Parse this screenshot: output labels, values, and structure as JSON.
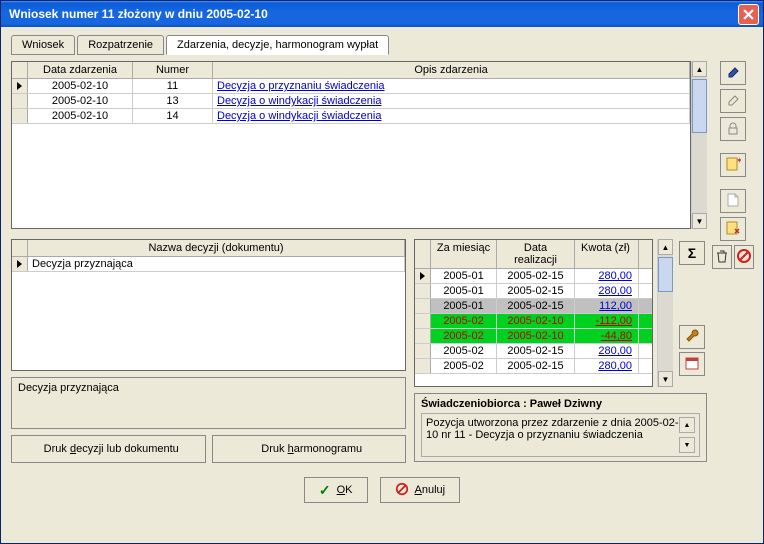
{
  "window_title": "Wniosek numer 11 złożony w dniu 2005-02-10",
  "tabs": [
    "Wniosek",
    "Rozpatrzenie",
    "Zdarzenia, decyzje, harmonogram wypłat"
  ],
  "active_tab": 2,
  "events_grid": {
    "headers": {
      "date": "Data zdarzenia",
      "number": "Numer",
      "desc": "Opis zdarzenia"
    },
    "rows": [
      {
        "date": "2005-02-10",
        "number": "11",
        "desc": "Decyzja o przyznaniu świadczenia"
      },
      {
        "date": "2005-02-10",
        "number": "13",
        "desc": "Decyzja o windykacji świadczenia"
      },
      {
        "date": "2005-02-10",
        "number": "14",
        "desc": "Decyzja o windykacji świadczenia"
      }
    ],
    "selected_row": 0
  },
  "decisions_grid": {
    "header": "Nazwa decyzji (dokumentu)",
    "rows": [
      {
        "name": "Decyzja przyznająca"
      }
    ],
    "selected_row": 0
  },
  "decision_description": "Decyzja przyznająca",
  "schedule_grid": {
    "headers": {
      "month": "Za miesiąc",
      "date": "Data realizacji",
      "amount": "Kwota (zł)"
    },
    "rows": [
      {
        "month": "2005-01",
        "date": "2005-02-15",
        "amount": "280,00",
        "style": "blue",
        "selected": true
      },
      {
        "month": "2005-01",
        "date": "2005-02-15",
        "amount": "280,00",
        "style": "blue"
      },
      {
        "month": "2005-01",
        "date": "2005-02-15",
        "amount": "112,00",
        "style": "gray-blue"
      },
      {
        "month": "2005-02",
        "date": "2005-02-10",
        "amount": "-112,00",
        "style": "green-red"
      },
      {
        "month": "2005-02",
        "date": "2005-02-10",
        "amount": "-44,80",
        "style": "green-red"
      },
      {
        "month": "2005-02",
        "date": "2005-02-15",
        "amount": "280,00",
        "style": "blue"
      },
      {
        "month": "2005-02",
        "date": "2005-02-15",
        "amount": "280,00",
        "style": "blue"
      }
    ]
  },
  "recipient": {
    "label": "Świadczeniobiorca : Paweł Dziwny",
    "details": "Pozycja utworzona przez zdarzenie z dnia 2005-02-10 nr 11 - Decyzja o przyznaniu świadczenia"
  },
  "buttons": {
    "print_decision": {
      "pre": "Druk ",
      "key": "d",
      "post": "ecyzji lub dokumentu"
    },
    "print_schedule": {
      "pre": "Druk ",
      "key": "h",
      "post": "armonogramu"
    },
    "ok": {
      "key": "O",
      "post": "K"
    },
    "cancel": {
      "key": "A",
      "post": "nuluj"
    }
  }
}
